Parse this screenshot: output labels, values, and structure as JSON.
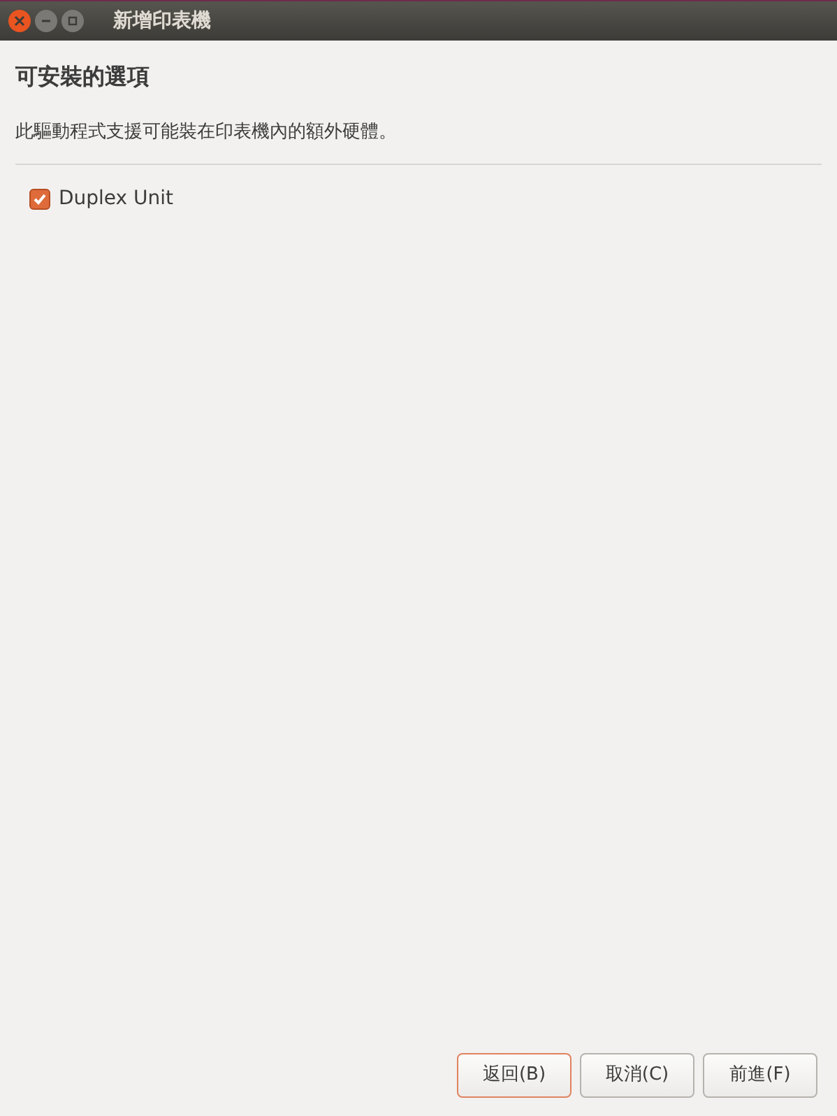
{
  "window": {
    "title": "新增印表機"
  },
  "heading": "可安裝的選項",
  "description": "此驅動程式支援可能裝在印表機內的額外硬體。",
  "options": [
    {
      "label": "Duplex Unit",
      "checked": true
    }
  ],
  "buttons": [
    {
      "label": "返回(B)",
      "focused": true
    },
    {
      "label": "取消(C)",
      "focused": false
    },
    {
      "label": "前進(F)",
      "focused": false
    }
  ]
}
